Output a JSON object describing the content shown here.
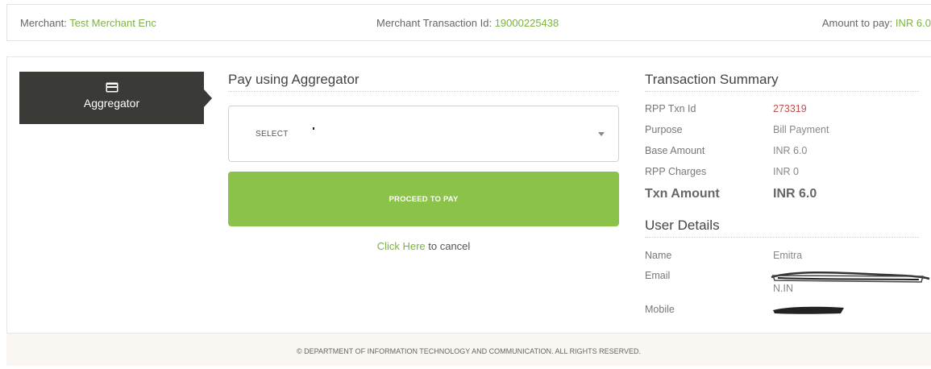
{
  "topbar": {
    "merchant_label": "Merchant:",
    "merchant_value": "Test Merchant Enc",
    "txn_label": "Merchant Transaction Id:",
    "txn_value": "19000225438",
    "amount_label": "Amount to pay:",
    "amount_value": "INR 6.0"
  },
  "tab": {
    "label": "Aggregator",
    "icon": "credit-card-icon"
  },
  "payment": {
    "title": "Pay using Aggregator",
    "select_value": "SELECT",
    "proceed_label": "PROCEED TO PAY",
    "cancel_link": "Click Here",
    "cancel_text": " to cancel"
  },
  "summary": {
    "title": "Transaction Summary",
    "rows": [
      {
        "label": "RPP Txn Id",
        "value": "273319"
      },
      {
        "label": "Purpose",
        "value": "Bill Payment"
      },
      {
        "label": "Base Amount",
        "value": "INR 6.0"
      },
      {
        "label": "RPP Charges",
        "value": "INR 0"
      },
      {
        "label": "Txn Amount",
        "value": "INR 6.0"
      }
    ]
  },
  "user": {
    "title": "User Details",
    "rows": [
      {
        "label": "Name",
        "value": "Emitra"
      },
      {
        "label": "Email",
        "value": "N.IN"
      },
      {
        "label": "Mobile",
        "value": ""
      }
    ]
  },
  "footer": {
    "text": "© DEPARTMENT OF INFORMATION TECHNOLOGY AND COMMUNICATION. ALL RIGHTS RESERVED."
  },
  "colors": {
    "accent_green": "#8bc34a",
    "link_green": "#7cb342",
    "tab_dark": "#3a3a36",
    "txn_id_red": "#c0504d"
  }
}
